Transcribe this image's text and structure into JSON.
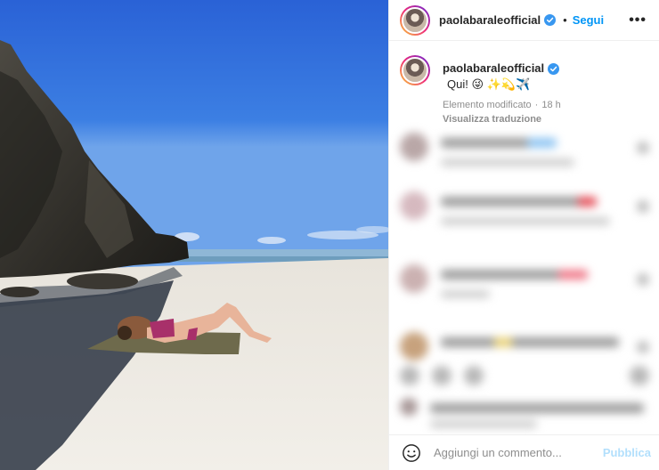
{
  "post": {
    "username": "paolabaraleofficial",
    "follow_label": "Segui",
    "dot_separator": "•",
    "more_label": "•••",
    "caption_text": "Qui! 😜 ✨💫✈️",
    "edited_label": "Elemento modificato",
    "meta_separator": "·",
    "time_ago": "18 h",
    "translate_label": "Visualizza traduzione"
  },
  "comment_box": {
    "placeholder": "Aggiungi un commento...",
    "publish_label": "Pubblica"
  },
  "icons": {
    "verified": "verified-badge-icon",
    "emoji": "emoji-smiley-icon",
    "more": "more-options-icon"
  },
  "colors": {
    "accent": "#0095f6",
    "publish_disabled": "#b2dffc",
    "verified": "#3897f0",
    "secondary_text": "#8e8e8e"
  }
}
